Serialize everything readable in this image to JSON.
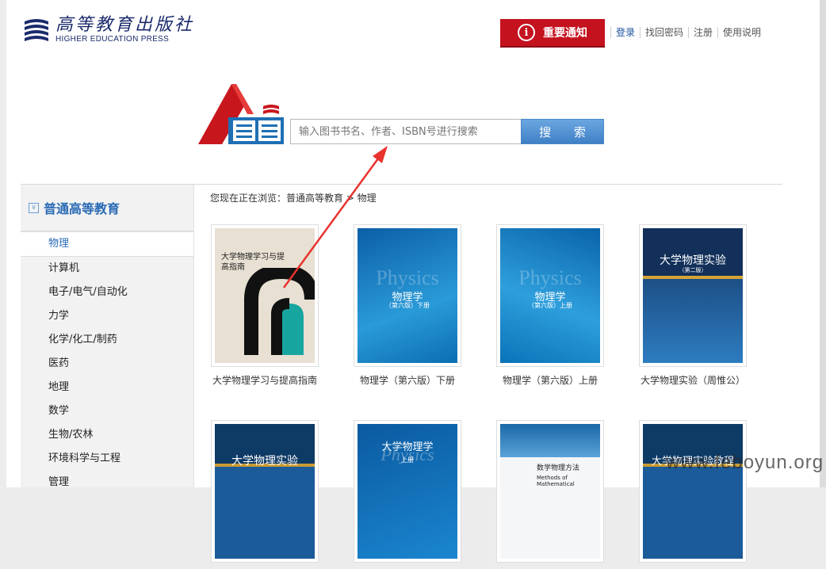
{
  "header": {
    "logo_cn": "高等教育出版社",
    "logo_en": "HIGHER EDUCATION PRESS",
    "notice_label": "重要通知",
    "links": [
      "登录",
      "找回密码",
      "注册",
      "使用说明"
    ]
  },
  "search": {
    "placeholder": "输入图书书名、作者、ISBN号进行搜索",
    "button_label": "搜 索"
  },
  "sidebar": {
    "heading": "普通高等教育",
    "items": [
      "物理",
      "计算机",
      "电子/电气/自动化",
      "力学",
      "化学/化工/制药",
      "医药",
      "地理",
      "数学",
      "生物/农林",
      "环境科学与工程",
      "管理"
    ],
    "active": "物理"
  },
  "breadcrumb": "您现在正在浏览：普通高等教育 > 物理",
  "books": [
    {
      "title": "大学物理学习与提高指南",
      "cover_title": "大学物理学习与提高指南"
    },
    {
      "title": "物理学（第六版）下册",
      "cover_title": "物理学",
      "cover_sub": "（第六版）下册",
      "cover_watermark": "Physics"
    },
    {
      "title": "物理学（第六版）上册",
      "cover_title": "物理学",
      "cover_sub": "（第六版）上册",
      "cover_watermark": "Physics"
    },
    {
      "title": "大学物理实验（周惟公）",
      "cover_title": "大学物理实验",
      "cover_sub": "（第二版）"
    },
    {
      "title": "",
      "cover_title": "大学物理实验"
    },
    {
      "title": "",
      "cover_title": "大学物理学",
      "cover_watermark": "Physics",
      "cover_sub": "上册"
    },
    {
      "title": "",
      "cover_title": "数学物理方法",
      "cover_sub": "Methods of Mathematical"
    },
    {
      "title": "",
      "cover_title": "大学物理实验教程"
    }
  ],
  "watermark": "www.feboyun.org",
  "colors": {
    "brand_blue": "#1a2a6c",
    "notice_red": "#c4121f",
    "link_blue": "#2a6bb5"
  }
}
